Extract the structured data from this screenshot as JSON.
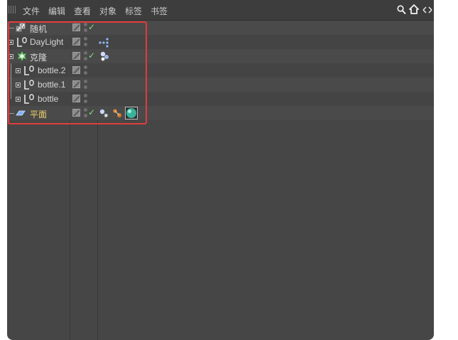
{
  "menu": {
    "items": [
      "文件",
      "编辑",
      "查看",
      "对象",
      "标签",
      "书签"
    ],
    "tools": [
      "search-icon",
      "home-icon",
      "expand-icon"
    ]
  },
  "objects": [
    {
      "name": "随机",
      "icon": "random-effector-icon",
      "expandable": false,
      "check": true,
      "tags": []
    },
    {
      "name": "DayLight",
      "icon": "null-object-icon",
      "expandable": true,
      "check": false,
      "tags": [
        "sky-tag-icon"
      ]
    },
    {
      "name": "克隆",
      "icon": "cloner-icon",
      "expandable": true,
      "check": true,
      "tags": [
        "cloner-tag-icon"
      ]
    },
    {
      "name": "bottle.2",
      "icon": "null-object-icon",
      "expandable": true,
      "check": false,
      "tags": []
    },
    {
      "name": "bottle.1",
      "icon": "null-object-icon",
      "expandable": true,
      "check": false,
      "tags": []
    },
    {
      "name": "bottle",
      "icon": "null-object-icon",
      "expandable": true,
      "check": false,
      "tags": []
    },
    {
      "name": "平面",
      "icon": "plane-object-icon",
      "expandable": false,
      "check": true,
      "selected": true,
      "tags": [
        "render-tag-icon",
        "compositing-tag-icon",
        "material-tag-icon"
      ]
    }
  ],
  "colors": {
    "panel": "#464646",
    "menubar": "#3d3d3d",
    "selected_text": "#f2d46b",
    "highlight": "#e23b3b",
    "check": "#7ee07e"
  }
}
